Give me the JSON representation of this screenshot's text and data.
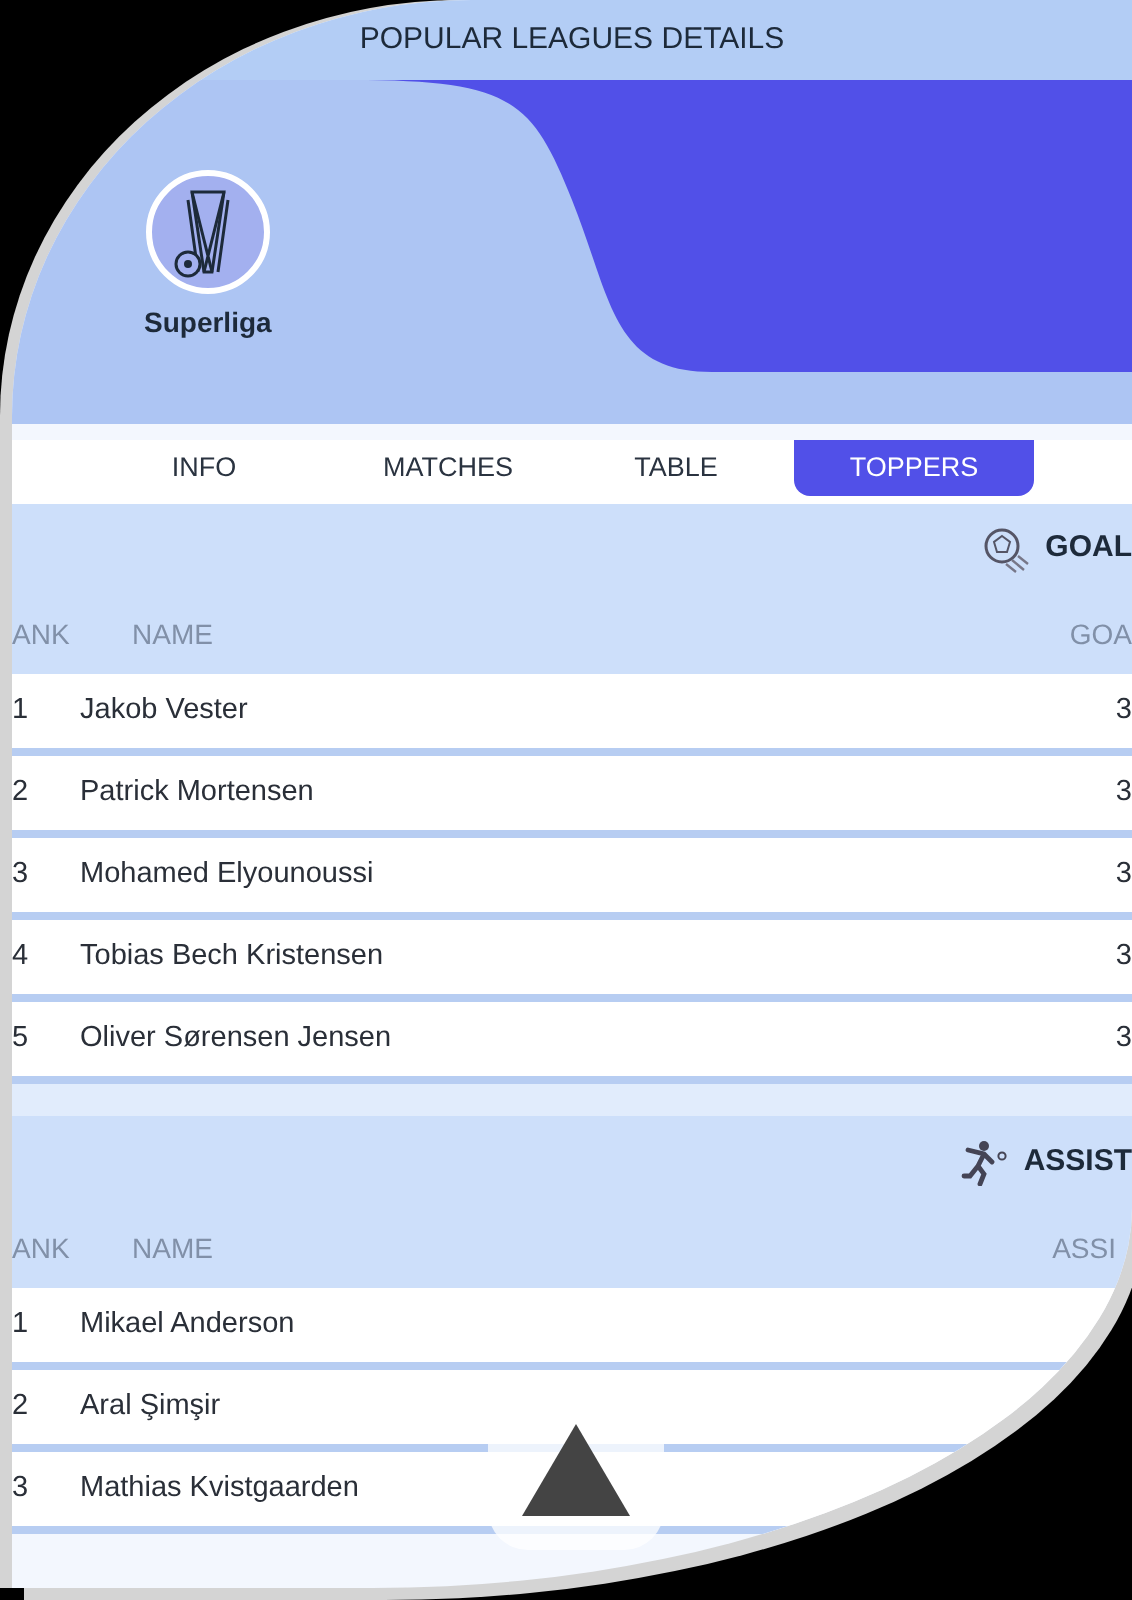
{
  "header": {
    "title": "POPULAR LEAGUES DETAILS"
  },
  "league": {
    "name": "Superliga"
  },
  "tabs": [
    {
      "label": "INFO",
      "selected": false
    },
    {
      "label": "MATCHES",
      "selected": false
    },
    {
      "label": "TABLE",
      "selected": false
    },
    {
      "label": "TOPPERS",
      "selected": true
    }
  ],
  "sections": [
    {
      "kind": "goals",
      "title": "GOAL",
      "columns": [
        "ANK",
        "NAME",
        "GOA"
      ],
      "rows": [
        {
          "rank": "1",
          "name": "Jakob Vester",
          "value": "3"
        },
        {
          "rank": "2",
          "name": "Patrick Mortensen",
          "value": "3"
        },
        {
          "rank": "3",
          "name": "Mohamed Elyounoussi",
          "value": "3"
        },
        {
          "rank": "4",
          "name": "Tobias Bech Kristensen",
          "value": "3"
        },
        {
          "rank": "5",
          "name": "Oliver Sørensen Jensen",
          "value": "3"
        }
      ]
    },
    {
      "kind": "assists",
      "title": "ASSIST",
      "columns": [
        "ANK",
        "NAME",
        "ASSI"
      ],
      "rows": [
        {
          "rank": "1",
          "name": "Mikael Anderson"
        },
        {
          "rank": "2",
          "name": "Aral Şimşir"
        },
        {
          "rank": "3",
          "name": "Mathias Kvistgaarden"
        }
      ]
    }
  ]
}
